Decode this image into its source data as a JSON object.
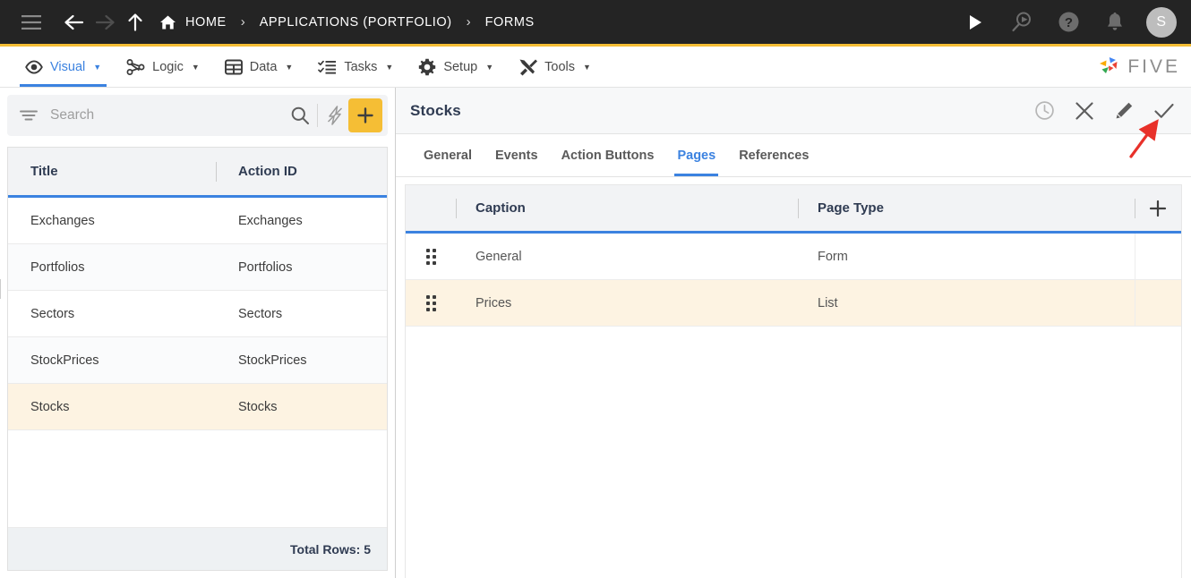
{
  "topbar": {
    "icons": [
      "menu-icon",
      "back-arrow-icon",
      "forward-arrow-icon",
      "up-arrow-icon"
    ],
    "home_label": "HOME",
    "breadcrumbs": [
      {
        "label": "HOME",
        "icon": "home-icon"
      },
      {
        "label": "APPLICATIONS (PORTFOLIO)",
        "icon": ""
      },
      {
        "label": "FORMS",
        "icon": ""
      }
    ],
    "separator": "›",
    "right_icons": [
      "play-icon",
      "search-run-icon",
      "help-icon",
      "bell-icon"
    ],
    "avatar_initial": "S",
    "accent_color": "#F5BE35",
    "background_color": "#242424"
  },
  "navbar": {
    "items": [
      {
        "label": "Visual",
        "icon": "eye-icon",
        "active": true
      },
      {
        "label": "Logic",
        "icon": "nodes-icon",
        "active": false
      },
      {
        "label": "Data",
        "icon": "table-grid-icon",
        "active": false
      },
      {
        "label": "Tasks",
        "icon": "checklist-icon",
        "active": false
      },
      {
        "label": "Setup",
        "icon": "gear-icon",
        "active": false
      },
      {
        "label": "Tools",
        "icon": "tools-icon",
        "active": false
      }
    ],
    "caret": "▼",
    "logo_text": "FIVE",
    "active_color": "#3b82e0"
  },
  "left_panel": {
    "search": {
      "placeholder": "Search",
      "value": ""
    },
    "filter_icon": "filter-icon",
    "search_icon": "search-icon",
    "lightning_icon": "lightning-bolt-icon",
    "add_label": "+",
    "columns": [
      "Title",
      "Action ID"
    ],
    "rows": [
      {
        "title": "Exchanges",
        "action_id": "Exchanges",
        "selected": false
      },
      {
        "title": "Portfolios",
        "action_id": "Portfolios",
        "selected": false
      },
      {
        "title": "Sectors",
        "action_id": "Sectors",
        "selected": false
      },
      {
        "title": "StockPrices",
        "action_id": "StockPrices",
        "selected": false
      },
      {
        "title": "Stocks",
        "action_id": "Stocks",
        "selected": true
      }
    ],
    "total_rows_label": "Total Rows: 5",
    "selected_row_color": "#FDF3E2"
  },
  "right_panel": {
    "title": "Stocks",
    "header_icons": [
      "history-clock-icon",
      "close-x-icon",
      "edit-pencil-icon",
      "save-check-icon"
    ],
    "tabs": [
      {
        "label": "General",
        "active": false
      },
      {
        "label": "Events",
        "active": false
      },
      {
        "label": "Action Buttons",
        "active": false
      },
      {
        "label": "Pages",
        "active": true
      },
      {
        "label": "References",
        "active": false
      }
    ],
    "grid": {
      "columns": [
        "Caption",
        "Page Type"
      ],
      "add_label": "+",
      "rows": [
        {
          "drag": "drag-handle-icon",
          "caption": "General",
          "page_type": "Form",
          "selected": false
        },
        {
          "drag": "drag-handle-icon",
          "caption": "Prices",
          "page_type": "List",
          "selected": true
        }
      ]
    }
  },
  "annotation": {
    "arrow_color": "#e8312a",
    "points_to": "save-check-icon"
  }
}
